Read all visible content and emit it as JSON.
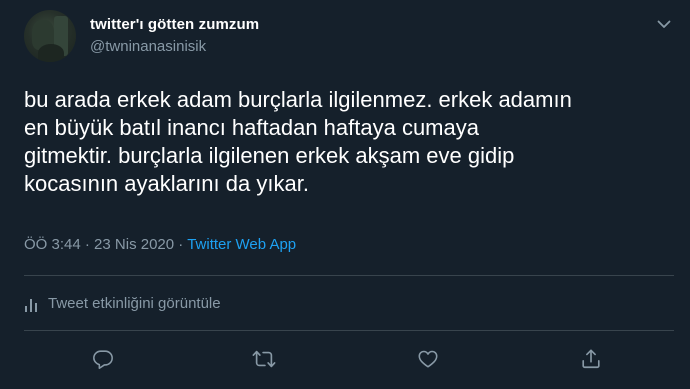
{
  "user": {
    "display_name": "twitter'ı götten zumzum",
    "handle": "@twninanasinisik"
  },
  "tweet": {
    "text": "bu arada erkek adam burçlarla ilgilenmez. erkek adamın\nen büyük batıl inancı haftadan haftaya cumaya\ngitmektir. burçlarla ilgilenen erkek akşam eve gidip\nkocasının ayaklarını da yıkar.",
    "time": "ÖÖ 3:44",
    "separator": "·",
    "date": "23 Nis 2020",
    "source": "Twitter Web App"
  },
  "activity": {
    "label": "Tweet etkinliğini görüntüle"
  },
  "icons": {
    "caret": "chevron-down-icon",
    "stats": "bar-chart-icon",
    "reply": "reply-icon",
    "retweet": "retweet-icon",
    "like": "heart-icon",
    "share": "share-icon"
  },
  "colors": {
    "background": "#15202b",
    "primary_text": "#ffffff",
    "secondary_text": "#8899a6",
    "link": "#1da1f2",
    "border": "#38444d"
  }
}
